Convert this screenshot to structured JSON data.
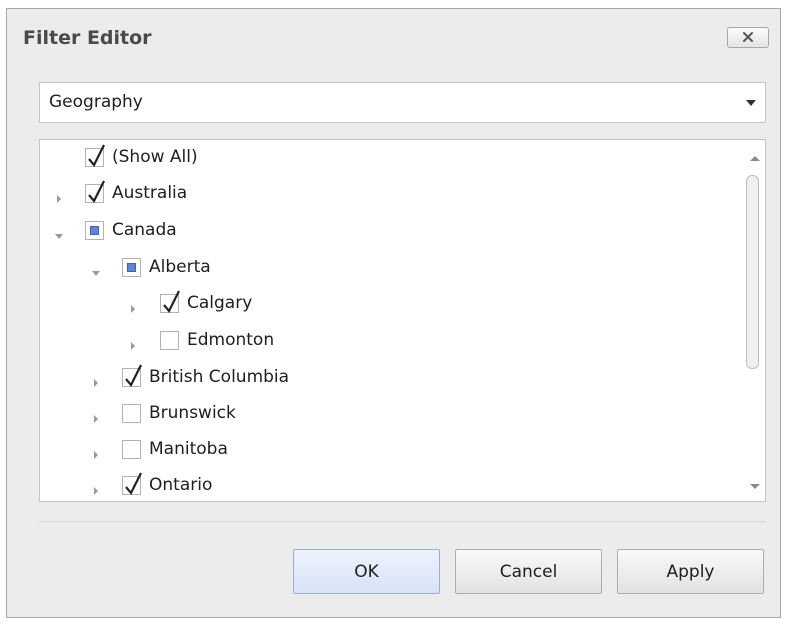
{
  "dialog": {
    "title": "Filter Editor",
    "close_icon": "close-icon"
  },
  "field_selector": {
    "value": "Geography"
  },
  "tree": {
    "items": [
      {
        "label": "(Show All)",
        "state": "checked",
        "expander": "none"
      },
      {
        "label": "Australia",
        "state": "checked",
        "expander": "collapsed"
      },
      {
        "label": "Canada",
        "state": "indeterminate",
        "expander": "expanded"
      },
      {
        "label": "Alberta",
        "state": "indeterminate",
        "expander": "expanded"
      },
      {
        "label": "Calgary",
        "state": "checked",
        "expander": "collapsed"
      },
      {
        "label": "Edmonton",
        "state": "unchecked",
        "expander": "collapsed"
      },
      {
        "label": "British Columbia",
        "state": "checked",
        "expander": "collapsed"
      },
      {
        "label": "Brunswick",
        "state": "unchecked",
        "expander": "collapsed"
      },
      {
        "label": "Manitoba",
        "state": "unchecked",
        "expander": "collapsed"
      },
      {
        "label": "Ontario",
        "state": "checked",
        "expander": "collapsed"
      }
    ]
  },
  "buttons": {
    "ok": "OK",
    "cancel": "Cancel",
    "apply": "Apply"
  },
  "colors": {
    "indeterminate": "#5f86d6",
    "default_button": "#d7e3fa"
  }
}
